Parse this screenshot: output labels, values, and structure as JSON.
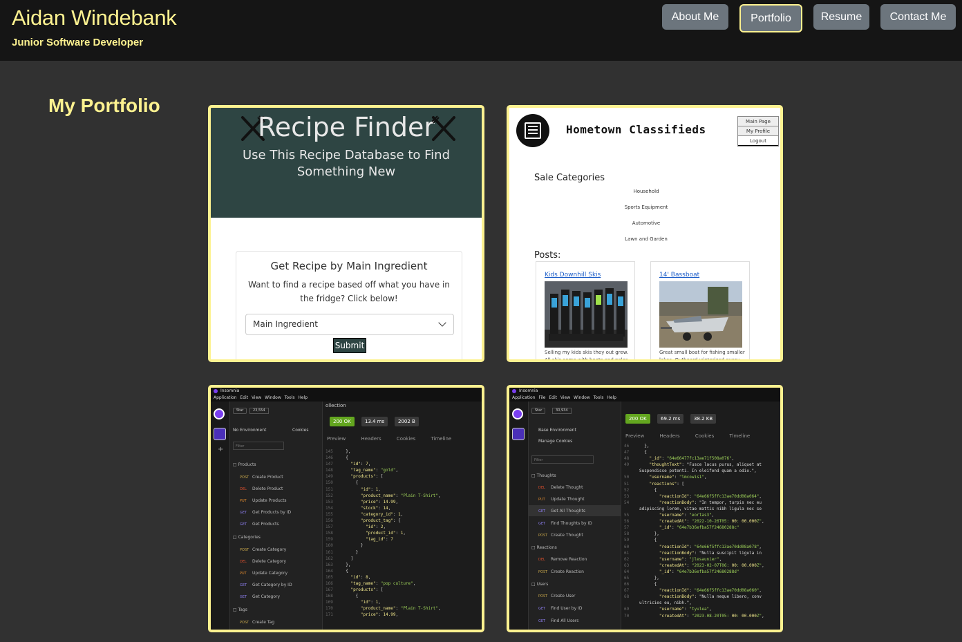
{
  "header": {
    "name": "Aidan Windebank",
    "role": "Junior Software Developer",
    "nav": [
      "About Me",
      "Portfolio",
      "Resume",
      "Contact Me"
    ]
  },
  "main": {
    "title": "My Portfolio"
  },
  "colors": {
    "accent": "#fdf290",
    "header_bg": "#151515",
    "page_bg": "#313131",
    "nav_btn": "#6c757d"
  },
  "recipe": {
    "title": "Recipe Finder",
    "subtitle_1": "Use This Recipe Database to Find",
    "subtitle_2": "Something New",
    "box_title": "Get Recipe by Main Ingredient",
    "box_text_1": "Want to find a recipe based off what you have in",
    "box_text_2": "the fridge? Click below!",
    "select_value": "Main Ingredient",
    "submit": "Submit"
  },
  "classifieds": {
    "title": "Hometown Classifieds",
    "logo_text": "NEWS",
    "menu": [
      "Main Page",
      "My Profile",
      "Logout"
    ],
    "sale_heading": "Sale Categories",
    "categories": [
      "Household",
      "Sports Equipment",
      "Automotive",
      "Lawn and Garden"
    ],
    "posts_heading": "Posts:",
    "posts": [
      {
        "title": "Kids Downhill Skis",
        "desc": "Selling my kids skis they out grew. All skis come with boots and poles"
      },
      {
        "title": "14' Bassboat",
        "desc": "Great small boat for fishing smaller lakes. Outboard winterized every year"
      }
    ]
  },
  "insomnia1": {
    "app": "Insomnia",
    "menu": "Application Edit View Window Tools Help",
    "star": "Star",
    "stars": "23,554",
    "environment": "No Environment",
    "cookies": "Cookies",
    "filter": "Filter",
    "collection": "ollection",
    "status": "200 OK",
    "time": "13.4 ms",
    "size": "2002 B",
    "tabs": "Preview Headers Cookies Timeline",
    "folders": [
      "Products",
      "Categories",
      "Tags"
    ],
    "items": [
      {
        "m": "POST",
        "label": "Create Product"
      },
      {
        "m": "DEL",
        "label": "Delete Product"
      },
      {
        "m": "PUT",
        "label": "Update Products"
      },
      {
        "m": "GET",
        "label": "Get Products by ID"
      },
      {
        "m": "GET",
        "label": "Get Products"
      },
      {
        "m": "POST",
        "label": "Create Category"
      },
      {
        "m": "DEL",
        "label": "Delete Category"
      },
      {
        "m": "PUT",
        "label": "Update Category"
      },
      {
        "m": "GET",
        "label": "Get Category by ID"
      },
      {
        "m": "GET",
        "label": "Get Category"
      },
      {
        "m": "POST",
        "label": "Create Tag"
      }
    ],
    "code_lines": [
      [
        "145",
        "  },"
      ],
      [
        "146",
        "  {"
      ],
      [
        "147",
        "    \"id\": 7,"
      ],
      [
        "148",
        "    \"tag_name\": \"gold\","
      ],
      [
        "149",
        "    \"products\": ["
      ],
      [
        "150",
        "      {"
      ],
      [
        "151",
        "        \"id\": 1,"
      ],
      [
        "152",
        "        \"product_name\": \"Plain T-Shirt\","
      ],
      [
        "153",
        "        \"price\": 14.99,"
      ],
      [
        "154",
        "        \"stock\": 14,"
      ],
      [
        "155",
        "        \"category_id\": 1,"
      ],
      [
        "156",
        "        \"product_tag\": {"
      ],
      [
        "157",
        "          \"id\": 2,"
      ],
      [
        "158",
        "          \"product_id\": 1,"
      ],
      [
        "159",
        "          \"tag_id\": 7"
      ],
      [
        "160",
        "        }"
      ],
      [
        "161",
        "      }"
      ],
      [
        "162",
        "    ]"
      ],
      [
        "163",
        "  },"
      ],
      [
        "164",
        "  {"
      ],
      [
        "165",
        "    \"id\": 8,"
      ],
      [
        "166",
        "    \"tag_name\": \"pop culture\","
      ],
      [
        "167",
        "    \"products\": ["
      ],
      [
        "168",
        "      {"
      ],
      [
        "169",
        "        \"id\": 1,"
      ],
      [
        "170",
        "        \"product_name\": \"Plain T-Shirt\","
      ],
      [
        "171",
        "        \"price\": 14.99,"
      ]
    ]
  },
  "insomnia2": {
    "app": "Insomnia",
    "menu": "Application File Edit View Window Tools Help",
    "star": "Star",
    "stars": "30,934",
    "environment": "Base Environment",
    "cookies": "Manage Cookies",
    "filter": "Filter",
    "status": "200 OK",
    "time": "69.2 ms",
    "size": "38.2 KB",
    "tabs": "Preview Headers Cookies Timeline",
    "folders": [
      "Thoughts",
      "Reactions",
      "Users"
    ],
    "items": [
      {
        "m": "DEL",
        "label": "Delete Thought"
      },
      {
        "m": "PUT",
        "label": "Update Thought"
      },
      {
        "m": "GET",
        "label": "Get All Thoughts"
      },
      {
        "m": "GET",
        "label": "Find Thoughts by ID"
      },
      {
        "m": "POST",
        "label": "Create Thought"
      },
      {
        "m": "DEL",
        "label": "Remove Reaction"
      },
      {
        "m": "POST",
        "label": "Create Reaction"
      },
      {
        "m": "POST",
        "label": "Create User"
      },
      {
        "m": "GET",
        "label": "Find User by ID"
      },
      {
        "m": "GET",
        "label": "Find All Users"
      }
    ],
    "code_lines": [
      [
        "46",
        "  },"
      ],
      [
        "47",
        "  {"
      ],
      [
        "48",
        "    \"_id\": \"64e66477fc13ae71f508a076\","
      ],
      [
        "49",
        "    \"thoughtText\": \"Fusce lacus purus, aliquet at"
      ],
      [
        "",
        "Suspendisse potenti. In eleifend quam a odio.\","
      ],
      [
        "50",
        "    \"username\": \"lmcowis1\","
      ],
      [
        "51",
        "    \"reactions\": ["
      ],
      [
        "52",
        "      {"
      ],
      [
        "53",
        "        \"reactionId\": \"64e66f5ffc13ae70dd08a064\","
      ],
      [
        "54",
        "        \"reactionBody\": \"In tempor, turpis nec eu"
      ],
      [
        "",
        "adipiscing lorem, vitae mattis nibh ligula nec se"
      ],
      [
        "55",
        "        \"username\": \"eortas3\","
      ],
      [
        "56",
        "        \"createdAt\": \"2022-10-26T05:00:00.000Z\","
      ],
      [
        "57",
        "        \"_id\": \"64e7b36efba57f24680288c\""
      ],
      [
        "58",
        "      },"
      ],
      [
        "59",
        "      {"
      ],
      [
        "60",
        "        \"reactionId\": \"64e66f5ffc13ae70dd08a078\","
      ],
      [
        "61",
        "        \"reactionBody\": \"Nulla suscipit ligula in"
      ],
      [
        "62",
        "        \"username\": \"jlesaunier\","
      ],
      [
        "63",
        "        \"createdAt\": \"2023-02-07T06:00:00.000Z\","
      ],
      [
        "64",
        "        \"_id\": \"64e7b36efba57f24680288d\""
      ],
      [
        "65",
        "      },"
      ],
      [
        "66",
        "      {"
      ],
      [
        "67",
        "        \"reactionId\": \"64e66f5ffc13ae70dd08a060\","
      ],
      [
        "68",
        "        \"reactionBody\": \"Nulla neque libero, conv"
      ],
      [
        "",
        "ultricies eu, nibh.\","
      ],
      [
        "69",
        "        \"username\": \"tyulea\","
      ],
      [
        "70",
        "        \"createdAt\": \"2023-08-20T05:00:00.000Z\","
      ]
    ]
  }
}
